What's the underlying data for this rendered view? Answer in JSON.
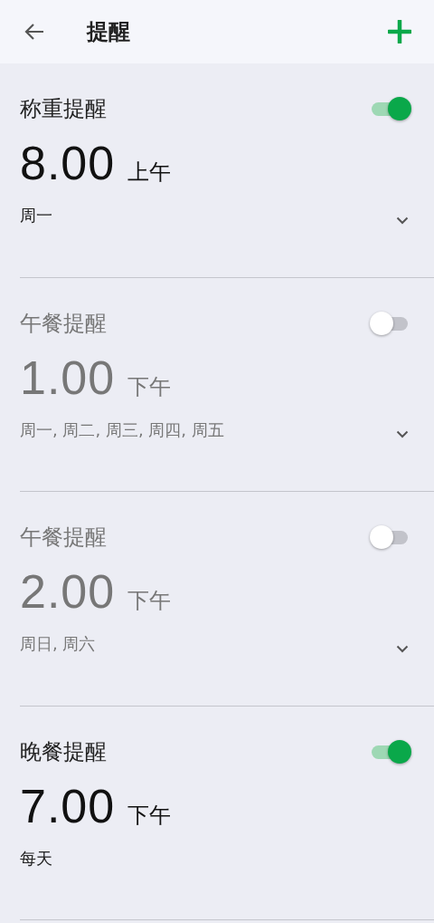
{
  "header": {
    "title": "提醒"
  },
  "reminders": [
    {
      "name": "称重提醒",
      "on": true,
      "time": "8.00",
      "period": "上午",
      "days": "周一",
      "chevron": true
    },
    {
      "name": "午餐提醒",
      "on": false,
      "time": "1.00",
      "period": "下午",
      "days": "周一, 周二, 周三, 周四, 周五",
      "chevron": true
    },
    {
      "name": "午餐提醒",
      "on": false,
      "time": "2.00",
      "period": "下午",
      "days": "周日, 周六",
      "chevron": true
    },
    {
      "name": "晚餐提醒",
      "on": true,
      "time": "7.00",
      "period": "下午",
      "days": "每天",
      "chevron": false
    }
  ]
}
